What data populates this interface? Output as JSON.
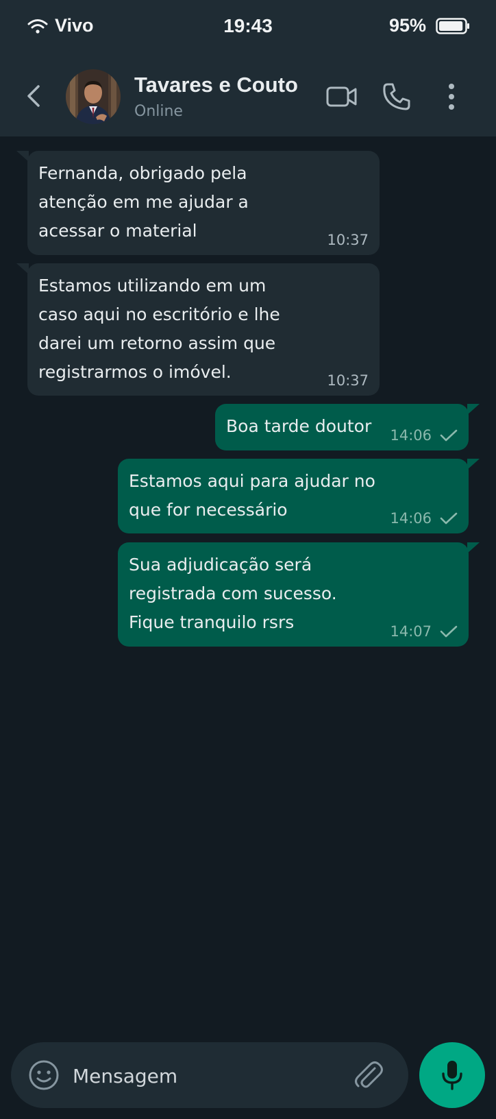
{
  "status_bar": {
    "carrier": "Vivo",
    "time": "19:43",
    "battery": "95%",
    "battery_level": 0.95
  },
  "header": {
    "contact_name": "Tavares e Couto",
    "contact_status": "Online",
    "icons": [
      "back-arrow-icon",
      "video-call-icon",
      "phone-call-icon",
      "more-vertical-icon"
    ]
  },
  "messages": [
    {
      "direction": "incoming",
      "text": "Fernanda, obrigado pela atenção em me ajudar a acessar o material",
      "time": "10:37"
    },
    {
      "direction": "incoming",
      "text": "Estamos utilizando em um caso aqui no escritório e lhe darei um retorno assim que registrarmos o imóvel.",
      "time": "10:37"
    },
    {
      "direction": "outgoing",
      "text": "Boa tarde doutor",
      "time": "14:06",
      "status": "sent"
    },
    {
      "direction": "outgoing",
      "text": "Estamos aqui para ajudar no que for necessário",
      "time": "14:06",
      "status": "sent"
    },
    {
      "direction": "outgoing",
      "text": "Sua adjudicação será registrada com sucesso. Fique tranquilo rsrs",
      "time": "14:07",
      "status": "sent"
    }
  ],
  "composer": {
    "placeholder": "Mensagem",
    "icons": [
      "emoji-icon",
      "attach-icon",
      "mic-icon"
    ]
  },
  "colors": {
    "background": "#121b22",
    "header": "#1f2c34",
    "incoming_bubble": "#202c33",
    "outgoing_bubble": "#005c4b",
    "accent": "#00a884"
  }
}
